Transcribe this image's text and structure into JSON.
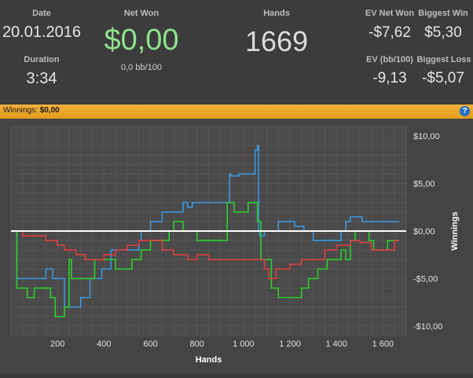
{
  "stats": {
    "date_label": "Date",
    "date_value": "20.01.2016",
    "duration_label": "Duration",
    "duration_value": "3:34",
    "netwon_label": "Net Won",
    "netwon_value": "$0,00",
    "netwon_sub": "0,0 bb/100",
    "hands_label": "Hands",
    "hands_value": "1669",
    "ev_net_label": "EV Net Won",
    "ev_net_value": "-$7,62",
    "ev_bb_label": "EV (bb/100)",
    "ev_bb_value": "-9,13",
    "big_win_label": "Biggest Win",
    "big_win_value": "$5,30",
    "big_loss_label": "Biggest Loss",
    "big_loss_value": "-$5,07"
  },
  "bar": {
    "winnings_label": "Winnings:",
    "winnings_value": "$0,00",
    "help_glyph": "?"
  },
  "colors": {
    "net_won": "#8ee28e",
    "blue": "#3a97e0",
    "green": "#2ecc2e",
    "red": "#e04040",
    "zero_line": "#ffffff"
  },
  "chart_data": {
    "type": "line",
    "xlabel": "Hands",
    "ylabel": "Winnings",
    "xlim": [
      0,
      1700
    ],
    "ylim": [
      -11,
      11
    ],
    "x_ticks": [
      200,
      400,
      600,
      800,
      1000,
      1200,
      1400,
      1600
    ],
    "x_tick_labels": [
      "200",
      "400",
      "600",
      "800",
      "1 000",
      "1 200",
      "1 400",
      "1 600"
    ],
    "y_ticks": [
      10,
      5,
      0,
      -5,
      -10
    ],
    "y_tick_labels": [
      "$10,00",
      "$5,00",
      "$0,00",
      "-$5,00",
      "-$10,00"
    ],
    "series": [
      {
        "color": "#3a97e0",
        "x": [
          0,
          20,
          25,
          100,
          150,
          180,
          230,
          300,
          340,
          390,
          430,
          500,
          550,
          560,
          600,
          650,
          700,
          740,
          760,
          780,
          800,
          850,
          900,
          940,
          945,
          980,
          1000,
          1050,
          1060,
          1065,
          1070,
          1090,
          1120,
          1130,
          1150,
          1200,
          1220,
          1260,
          1300,
          1320,
          1350,
          1400,
          1420,
          1440,
          1460,
          1490,
          1510,
          1550,
          1600,
          1620,
          1640,
          1650,
          1669
        ],
        "y": [
          0,
          0,
          -5,
          -5,
          -4,
          -5,
          -8,
          -7,
          -5,
          -4,
          -2,
          -2,
          -1,
          0,
          1,
          2,
          2,
          3,
          2.5,
          3,
          3,
          3,
          3,
          6,
          5.8,
          6,
          6,
          8.5,
          9,
          0,
          -0.5,
          0,
          0,
          0,
          1,
          1,
          0.5,
          0,
          -1,
          -1,
          -1,
          -1,
          0,
          1,
          1.5,
          1.5,
          1,
          1,
          1,
          1,
          1,
          1,
          1
        ]
      },
      {
        "color": "#2ecc2e",
        "x": [
          0,
          20,
          25,
          60,
          70,
          100,
          140,
          170,
          190,
          230,
          250,
          260,
          300,
          340,
          360,
          400,
          450,
          500,
          520,
          560,
          600,
          640,
          680,
          700,
          740,
          760,
          800,
          850,
          900,
          930,
          960,
          1000,
          1020,
          1040,
          1060,
          1075,
          1100,
          1120,
          1150,
          1200,
          1250,
          1280,
          1300,
          1320,
          1340,
          1360,
          1400,
          1420,
          1440,
          1460,
          1480,
          1500,
          1540,
          1560,
          1600,
          1620,
          1640,
          1669
        ],
        "y": [
          0,
          0,
          -6,
          -6,
          -7,
          -6,
          -6,
          -7,
          -9,
          -8,
          -3,
          -5,
          -5,
          -5,
          -3,
          -3,
          -4,
          -4,
          -3,
          -2,
          -1,
          -1,
          0,
          1,
          0,
          0,
          -1,
          -1,
          -1,
          3,
          2,
          2,
          3,
          3,
          1,
          -3,
          -3,
          -6,
          -7,
          -7,
          -6,
          -5,
          -5,
          -4,
          -4,
          -3,
          -3,
          -2,
          -3,
          -1,
          0,
          0,
          -1,
          -2,
          -2,
          -1,
          -1,
          -1
        ]
      },
      {
        "color": "#e04040",
        "x": [
          0,
          20,
          50,
          100,
          150,
          200,
          230,
          280,
          320,
          360,
          400,
          450,
          500,
          550,
          600,
          650,
          700,
          760,
          800,
          850,
          900,
          950,
          1000,
          1050,
          1090,
          1110,
          1140,
          1200,
          1250,
          1300,
          1350,
          1400,
          1440,
          1460,
          1500,
          1550,
          1600,
          1650,
          1669
        ],
        "y": [
          0,
          0,
          -0.5,
          -0.5,
          -1,
          -1.5,
          -2,
          -2.5,
          -3,
          -3,
          -2.5,
          -2,
          -1.5,
          -1,
          -1,
          -2,
          -2.5,
          -3,
          -2.5,
          -3,
          -3,
          -3,
          -3,
          -3,
          -4,
          -5,
          -4,
          -3.5,
          -3,
          -3,
          -2,
          -1.5,
          -1.5,
          -1,
          -1.2,
          -2,
          -2,
          -1,
          -1
        ]
      }
    ]
  }
}
